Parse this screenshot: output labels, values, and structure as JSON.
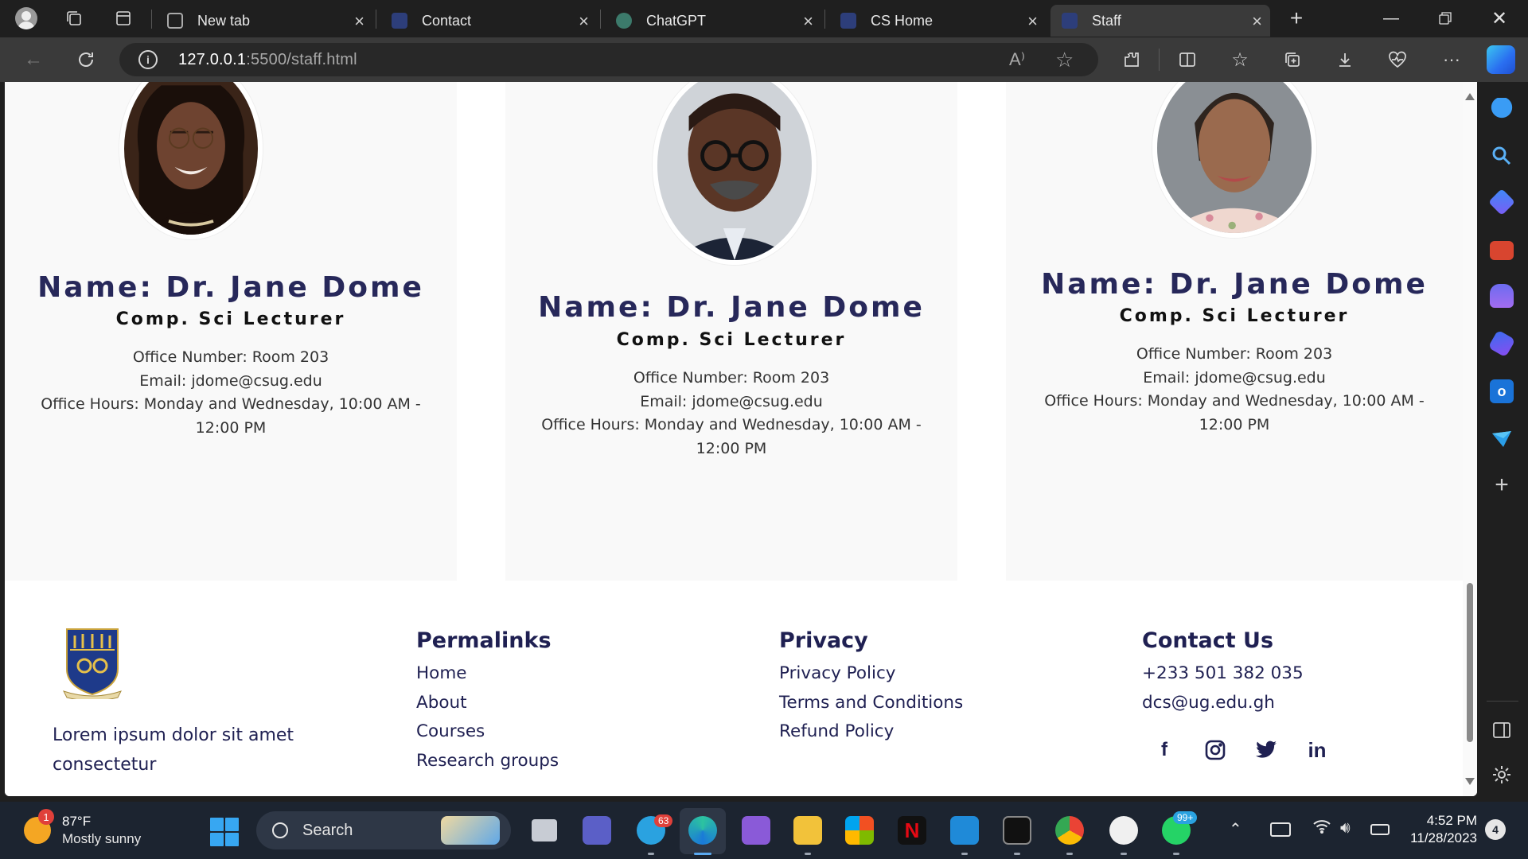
{
  "browser": {
    "tabs": [
      {
        "title": "New tab",
        "favicon_color": "#5a5a5a"
      },
      {
        "title": "Contact",
        "favicon_color": "#2d3e7a"
      },
      {
        "title": "ChatGPT",
        "favicon_color": "#3c7a6b"
      },
      {
        "title": "CS Home",
        "favicon_color": "#2d3e7a"
      },
      {
        "title": "Staff",
        "favicon_color": "#2d3e7a"
      }
    ],
    "active_tab": "Staff",
    "url_host": "127.0.0.1",
    "url_rest": ":5500/staff.html"
  },
  "staff": [
    {
      "name": "Name: Dr. Jane Dome",
      "role": "Comp. Sci Lecturer",
      "office": "Office Number: Room 203",
      "email": "Email: jdome@csug.edu",
      "hours_line1": "Office Hours: Monday and Wednesday, 10:00 AM -",
      "hours_line2": "12:00 PM"
    },
    {
      "name": "Name: Dr. Jane Dome",
      "role": "Comp. Sci Lecturer",
      "office": "Office Number: Room 203",
      "email": "Email: jdome@csug.edu",
      "hours_line1": "Office Hours: Monday and Wednesday, 10:00 AM -",
      "hours_line2": "12:00 PM"
    },
    {
      "name": "Name: Dr. Jane Dome",
      "role": "Comp. Sci Lecturer",
      "office": "Office Number: Room 203",
      "email": "Email: jdome@csug.edu",
      "hours_line1": "Office Hours: Monday and Wednesday, 10:00 AM -",
      "hours_line2": "12:00 PM"
    }
  ],
  "footer": {
    "about_line1": "Lorem ipsum dolor sit amet",
    "about_line2": "consectetur",
    "permalinks": {
      "heading": "Permalinks",
      "links": [
        "Home",
        "About",
        "Courses",
        "Research groups"
      ]
    },
    "privacy": {
      "heading": "Privacy",
      "links": [
        "Privacy Policy",
        "Terms and Conditions",
        "Refund Policy"
      ]
    },
    "contact": {
      "heading": "Contact Us",
      "phone": "+233 501 382 035",
      "email": "dcs@ug.edu.gh"
    },
    "socials": [
      "facebook-icon",
      "instagram-icon",
      "twitter-icon",
      "linkedin-icon"
    ]
  },
  "taskbar": {
    "weather_badge": "1",
    "weather_temp": "87°F",
    "weather_desc": "Mostly sunny",
    "search_label": "Search",
    "telegram_badge": "63",
    "whatsapp_badge": "99+",
    "time": "4:52 PM",
    "date": "11/28/2023",
    "notifications": "4"
  },
  "colors": {
    "heading_navy": "#27285a",
    "card_bg": "#f9f9f9",
    "page_bg": "#ffffff"
  }
}
